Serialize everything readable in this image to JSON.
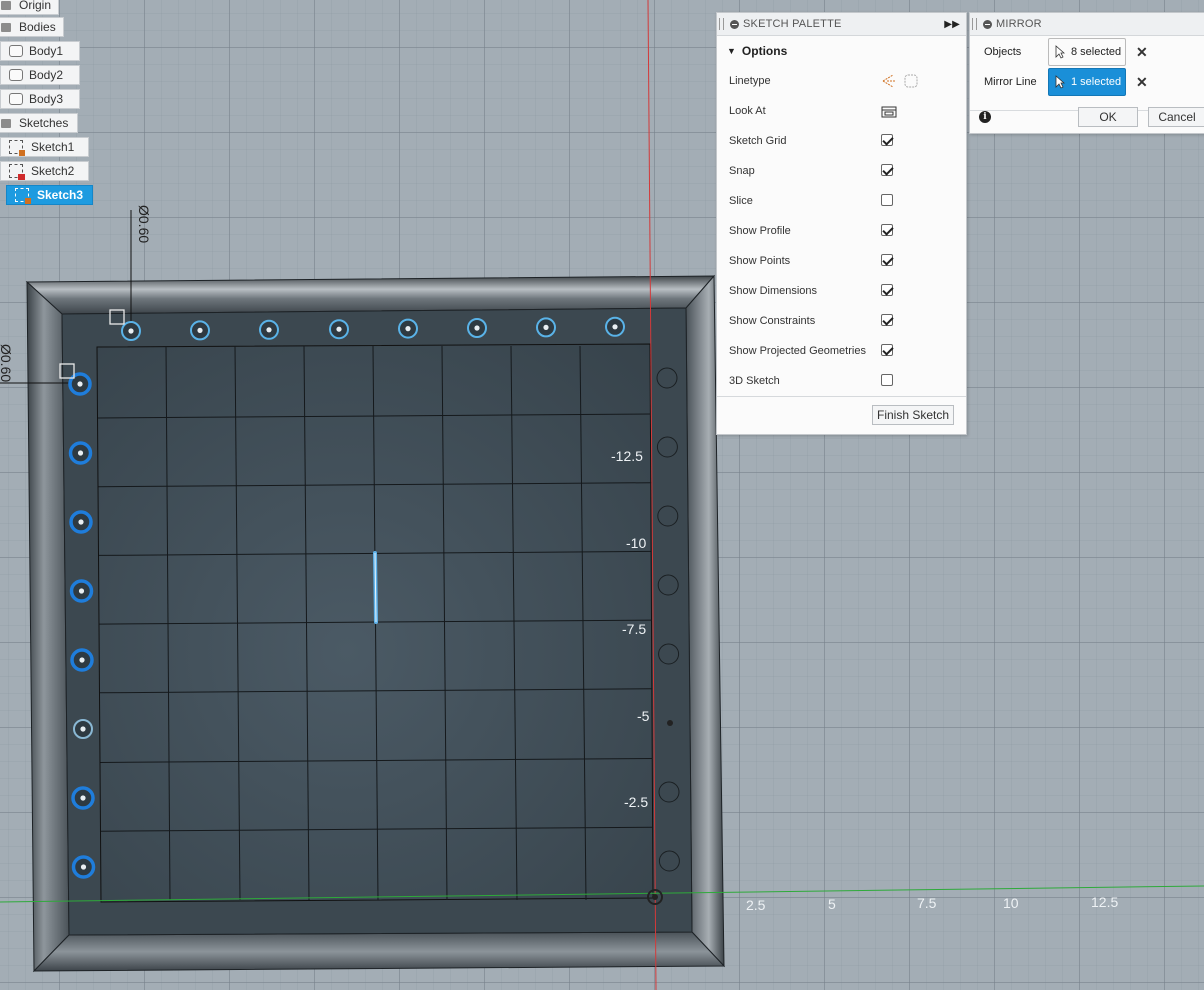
{
  "browser": {
    "items": [
      {
        "label": "Origin",
        "kind": "folder",
        "selected": false
      },
      {
        "label": "Bodies",
        "kind": "folder",
        "selected": false
      },
      {
        "label": "Body1",
        "kind": "body",
        "selected": false
      },
      {
        "label": "Body2",
        "kind": "body",
        "selected": false
      },
      {
        "label": "Body3",
        "kind": "body",
        "selected": false
      },
      {
        "label": "Sketches",
        "kind": "folder",
        "selected": false
      },
      {
        "label": "Sketch1",
        "kind": "sketch",
        "selected": false
      },
      {
        "label": "Sketch2",
        "kind": "sketch",
        "selected": false
      },
      {
        "label": "Sketch3",
        "kind": "sketch",
        "selected": true
      }
    ]
  },
  "viewport": {
    "dimensions": [
      "Ø0.60",
      "Ø0.60"
    ],
    "vertical_axis_labels": [
      "-12.5",
      "-10",
      "-7.5",
      "-5",
      "-2.5"
    ],
    "horizontal_axis_labels": [
      "2.5",
      "5",
      "7.5",
      "10",
      "12.5"
    ]
  },
  "sketch_palette": {
    "title": "SKETCH PALETTE",
    "options_label": "Options",
    "rows": [
      {
        "label": "Linetype",
        "type": "icons"
      },
      {
        "label": "Look At",
        "type": "icon"
      },
      {
        "label": "Sketch Grid",
        "type": "checkbox",
        "checked": true
      },
      {
        "label": "Snap",
        "type": "checkbox",
        "checked": true
      },
      {
        "label": "Slice",
        "type": "checkbox",
        "checked": false
      },
      {
        "label": "Show Profile",
        "type": "checkbox",
        "checked": true
      },
      {
        "label": "Show Points",
        "type": "checkbox",
        "checked": true
      },
      {
        "label": "Show Dimensions",
        "type": "checkbox",
        "checked": true
      },
      {
        "label": "Show Constraints",
        "type": "checkbox",
        "checked": true
      },
      {
        "label": "Show Projected Geometries",
        "type": "checkbox",
        "checked": true
      },
      {
        "label": "3D Sketch",
        "type": "checkbox",
        "checked": false
      }
    ],
    "finish_label": "Finish Sketch"
  },
  "mirror": {
    "title": "MIRROR",
    "objects_label": "Objects",
    "objects_value": "8 selected",
    "mirror_line_label": "Mirror Line",
    "mirror_line_value": "1 selected",
    "ok_label": "OK",
    "cancel_label": "Cancel",
    "info_icon": "i"
  },
  "colors": {
    "selection_blue": "#1a8fd8",
    "hole_blue": "#1f7ddb",
    "hole_light_blue": "#5ab3e8"
  }
}
